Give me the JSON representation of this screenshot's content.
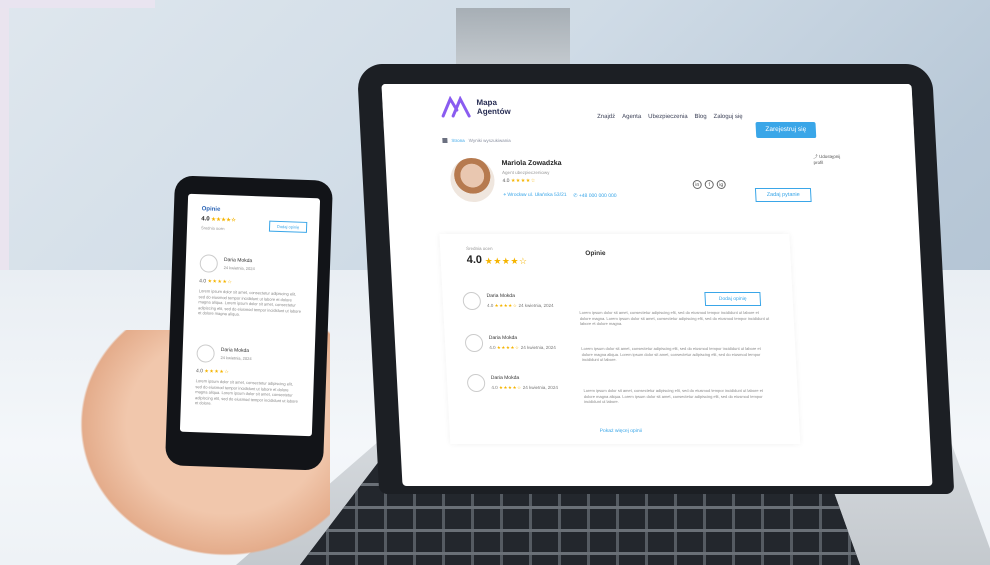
{
  "site": {
    "logo_text": "Mapa Agentów",
    "nav": [
      "Znajdź",
      "Agenta",
      "Ubezpieczenia",
      "Blog",
      "Zaloguj się"
    ],
    "join_label": "Zarejestruj się",
    "breadcrumb": [
      "Strona",
      "Wyniki wyszukiwania"
    ]
  },
  "agent": {
    "name": "Mariola Zowadzka",
    "role": "Agent ubezpieczeniowy",
    "rating": "4.0",
    "stars": "★★★★☆",
    "address": "Wrocław ul. Ułańska 53/21",
    "phone": "+48 000 000 000",
    "share_label": "Udostępnij profil",
    "contact_label": "Zadaj pytanie",
    "social": [
      "in",
      "f",
      "ig"
    ]
  },
  "reviews": {
    "title": "Opinie",
    "score_label": "Średnia ocen",
    "score": "4.0",
    "stars": "★★★★☆",
    "add_label": "Dodaj opinię",
    "show_more": "Pokaż więcej opinii",
    "items": [
      {
        "name": "Daria Mokda",
        "rating": "4.0",
        "stars": "★★★★☆",
        "date": "24 kwietnia, 2024",
        "text": "Lorem ipsum dolor sit amet, consectetur adipiscing elit, sed do eiusmod tempor incididunt ut labore et dolore magna. Lorem ipsum dolor sit amet, consectetur adipiscing elit, sed do eiusmod tempor incididunt ut labore et dolore magna."
      },
      {
        "name": "Daria Mokda",
        "rating": "4.0",
        "stars": "★★★★☆",
        "date": "24 kwietnia, 2024",
        "text": "Lorem ipsum dolor sit amet, consectetur adipiscing elit, sed do eiusmod tempor incididunt ut labore et dolore magna aliqua. Lorem ipsum dolor sit amet, consectetur adipiscing elit, sed do eiusmod tempor incididunt ut labore."
      },
      {
        "name": "Daria Mokda",
        "rating": "4.0",
        "stars": "★★★★☆",
        "date": "24 kwietnia, 2024",
        "text": "Lorem ipsum dolor sit amet, consectetur adipiscing elit, sed do eiusmod tempor incididunt ut labore et dolore magna aliqua. Lorem ipsum dolor sit amet, consectetur adipiscing elit, sed do eiusmod tempor incididunt ut labore."
      }
    ]
  },
  "phone": {
    "title": "Opinie",
    "score": "4.0",
    "stars": "★★★★☆",
    "sub": "Średnia ocen",
    "add_label": "Dodaj opinię",
    "items": [
      {
        "name": "Daria Mokda",
        "date": "24 kwietnia, 2024",
        "rating": "4.0",
        "stars": "★★★★☆",
        "text": "Lorem ipsum dolor sit amet, consectetur adipiscing elit, sed do eiusmod tempor incididunt ut labore et dolore magna aliqua. Lorem ipsum dolor sit amet, consectetur adipiscing elit, sed do eiusmod tempor incididunt ut labore et dolore magna aliqua."
      },
      {
        "name": "Daria Mokda",
        "date": "24 kwietnia, 2024",
        "rating": "4.0",
        "stars": "★★★★☆",
        "text": "Lorem ipsum dolor sit amet, consectetur adipiscing elit, sed do eiusmod tempor incididunt ut labore et dolore magna aliqua. Lorem ipsum dolor sit amet, consectetur adipiscing elit, sed do eiusmod tempor incididunt ut labore et dolore."
      }
    ]
  },
  "colors": {
    "accent": "#3aa6e8",
    "star": "#f5b400",
    "brand_dark": "#2a2f55"
  }
}
